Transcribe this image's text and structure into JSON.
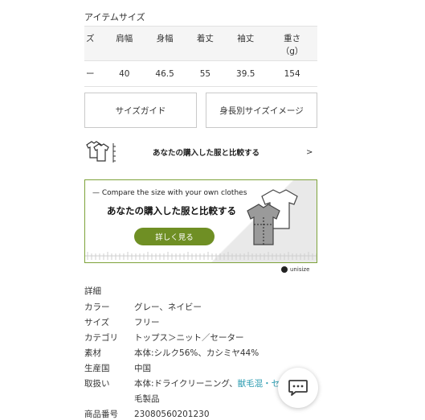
{
  "section_title": "アイテムサイズ",
  "size_table": {
    "headers": [
      "ズ",
      "肩幅",
      "身幅",
      "着丈",
      "袖丈",
      "重さ\n（g）"
    ],
    "rows": [
      [
        "ー",
        "40",
        "46.5",
        "55",
        "39.5",
        "154"
      ]
    ]
  },
  "buttons": {
    "size_guide": "サイズガイド",
    "height_size_image": "身長別サイズイメージ"
  },
  "compare": {
    "text": "あなたの購入した服と比較する",
    "arrow": ">"
  },
  "banner": {
    "english": "— Compare the size with your own clothes",
    "japanese": "あなたの購入した服と比較する",
    "button_label": "詳しく見る",
    "brand": "unisize",
    "accent_color": "#6f8f24"
  },
  "details": {
    "header": "詳細",
    "rows": [
      {
        "key": "カラー",
        "value": "グレー、ネイビー"
      },
      {
        "key": "サイズ",
        "value": "フリー"
      },
      {
        "key": "カテゴリ",
        "value": "トップス＞ニット／セーター",
        "link": true
      },
      {
        "key": "素材",
        "value": "本体:シルク56%、カシミヤ44%"
      },
      {
        "key": "生産国",
        "value": "中国"
      },
      {
        "key": "取扱い",
        "value": "本体:ドライクリーニング、",
        "link_value": "獣毛混・セ",
        "link_value_2": "毛製品"
      },
      {
        "key": "商品番号",
        "value": "23080560201230"
      }
    ]
  },
  "icons": {
    "chat": "chat-bubble-icon",
    "compare": "tshirt-compare-icon"
  }
}
